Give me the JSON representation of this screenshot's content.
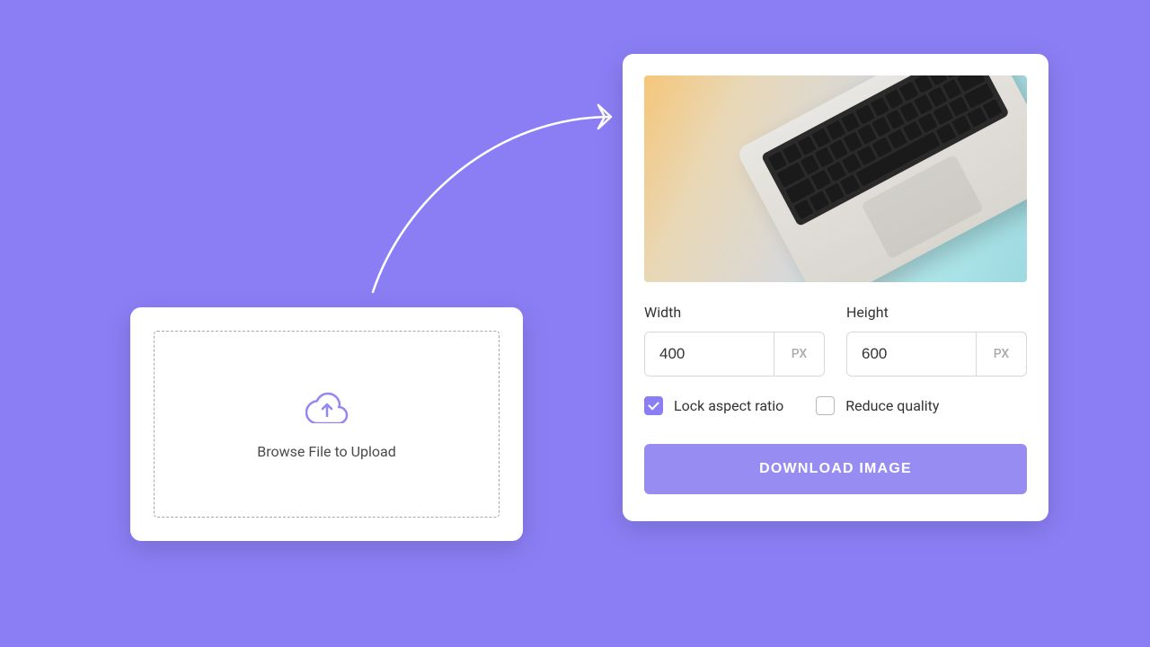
{
  "upload": {
    "prompt": "Browse File to Upload",
    "icon_name": "cloud-upload"
  },
  "editor": {
    "preview_description": "laptop photo",
    "dimensions": {
      "width": {
        "label": "Width",
        "value": "400",
        "unit": "PX"
      },
      "height": {
        "label": "Height",
        "value": "600",
        "unit": "PX"
      }
    },
    "options": {
      "lock_aspect": {
        "label": "Lock aspect ratio",
        "checked": true
      },
      "reduce_quality": {
        "label": "Reduce quality",
        "checked": false
      }
    },
    "download_label": "DOWNLOAD IMAGE"
  },
  "colors": {
    "background": "#8b7ef5",
    "accent": "#8b7ef5",
    "button": "#978cf2"
  }
}
